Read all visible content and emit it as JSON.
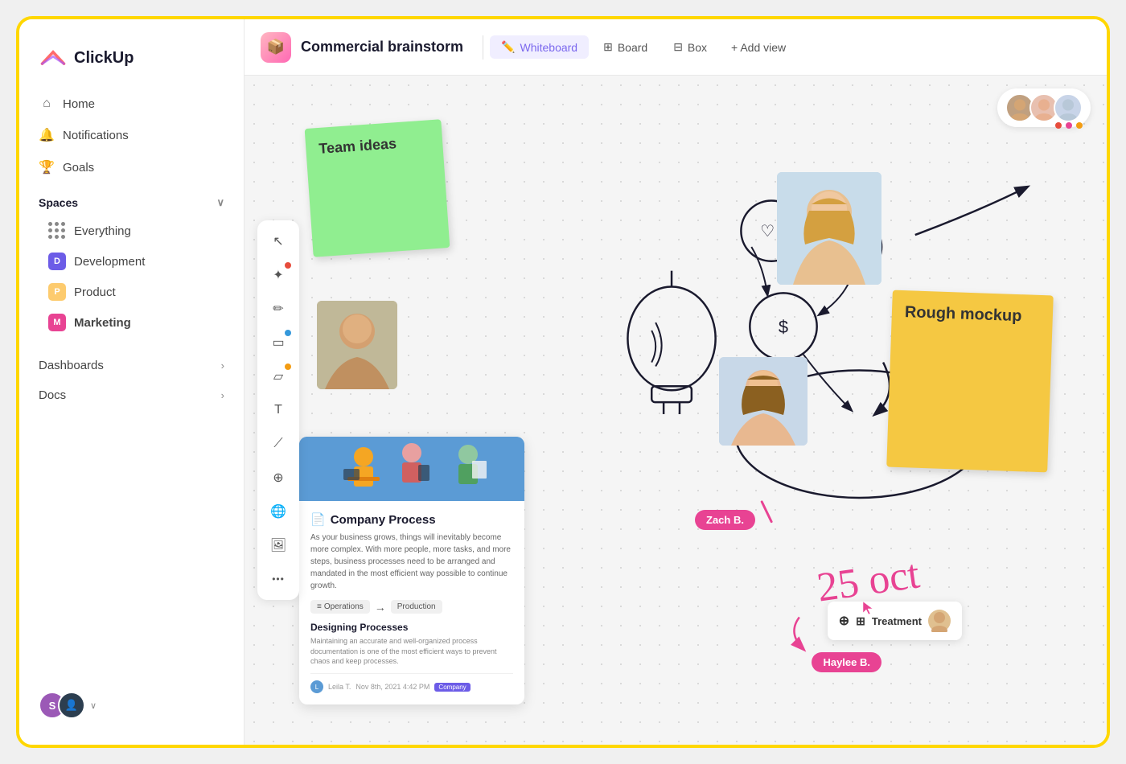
{
  "app": {
    "name": "ClickUp"
  },
  "sidebar": {
    "nav": [
      {
        "id": "home",
        "label": "Home",
        "icon": "🏠"
      },
      {
        "id": "notifications",
        "label": "Notifications",
        "icon": "🔔"
      },
      {
        "id": "goals",
        "label": "Goals",
        "icon": "🏆"
      }
    ],
    "spaces_label": "Spaces",
    "spaces": [
      {
        "id": "everything",
        "label": "Everything",
        "type": "everything"
      },
      {
        "id": "development",
        "label": "Development",
        "letter": "D",
        "color": "blue"
      },
      {
        "id": "product",
        "label": "Product",
        "letter": "P",
        "color": "yellow"
      },
      {
        "id": "marketing",
        "label": "Marketing",
        "letter": "M",
        "color": "pink",
        "bold": true
      }
    ],
    "dashboards_label": "Dashboards",
    "docs_label": "Docs"
  },
  "header": {
    "page_icon": "📦",
    "page_title": "Commercial brainstorm",
    "views": [
      {
        "id": "whiteboard",
        "label": "Whiteboard",
        "icon": "✏️",
        "active": true
      },
      {
        "id": "board",
        "label": "Board",
        "icon": "⊞"
      },
      {
        "id": "box",
        "label": "Box",
        "icon": "⊟"
      }
    ],
    "add_view_label": "+ Add view"
  },
  "whiteboard": {
    "sticky_green_label": "Team ideas",
    "sticky_yellow_label": "Rough mockup",
    "doc_title": "Company Process",
    "doc_text": "As your business grows, things will inevitably become more complex. With more people, more tasks, and more steps, business processes need to be arranged and mandated in the most efficient way possible to continue growth.",
    "doc_flow_from": "Operations",
    "doc_flow_to": "Production",
    "doc_section": "Designing Processes",
    "doc_section_text": "Maintaining an accurate and well-organized process documentation is one of the most efficient ways to prevent chaos and keep processes.",
    "doc_author": "Leila T.",
    "doc_date": "Nov 8th, 2021 4:42 PM",
    "doc_tag": "Company",
    "date_text": "25 oct",
    "name_tag_1": "Zach B.",
    "name_tag_2": "Haylee B.",
    "treatment_label": "Treatment"
  },
  "toolbar": {
    "tools": [
      {
        "id": "cursor",
        "icon": "↖",
        "dot": null
      },
      {
        "id": "shapes",
        "icon": "✦",
        "dot": "red"
      },
      {
        "id": "pen",
        "icon": "✏",
        "dot": null
      },
      {
        "id": "rectangle",
        "icon": "▭",
        "dot": "blue"
      },
      {
        "id": "note",
        "icon": "▱",
        "dot": null
      },
      {
        "id": "text",
        "icon": "T",
        "dot": null
      },
      {
        "id": "draw",
        "icon": "⟋",
        "dot": null
      },
      {
        "id": "connect",
        "icon": "⊕",
        "dot": null
      },
      {
        "id": "globe",
        "icon": "🌐",
        "dot": null
      },
      {
        "id": "image",
        "icon": "🖼",
        "dot": null
      },
      {
        "id": "more",
        "icon": "···",
        "dot": null
      }
    ]
  }
}
